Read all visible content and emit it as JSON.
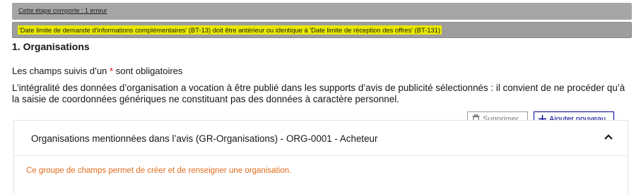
{
  "errors": {
    "count_text": "Cette étape comporte : 1 erreur",
    "message": "'Date limite de demande d'informations complémentaires' (BT-13) doit être antérieur ou identique à 'Date limite de réception des offres' (BT-131)"
  },
  "section": {
    "title": "1. Organisations",
    "required_note_before": "Les champs suivis d’un",
    "required_star": "*",
    "required_note_after": "sont obligatoires",
    "info": "L’intégralité des données d’organisation a vocation à être publié dans les supports d’avis de publicité sélectionnés : il convient de ne procéder qu’à la saisie de coordonnées génériques ne constituant pas des données à caractère personnel."
  },
  "actions": {
    "delete_label": "Supprimer",
    "add_label": "Ajouter nouveau",
    "delete_icon": "trash-icon",
    "add_icon": "plus-icon"
  },
  "panel": {
    "title": "Organisations mentionnées dans l’avis (GR-Organisations) - ORG-0001 - Acheteur",
    "help": "Ce groupe de champs permet de créer et de renseigner une organisation.",
    "toggle_icon": "chevron-up-icon"
  },
  "colors": {
    "primary": "#000091",
    "required": "#e1000f",
    "help": "#e06c1c",
    "highlight": "#e8e800"
  }
}
